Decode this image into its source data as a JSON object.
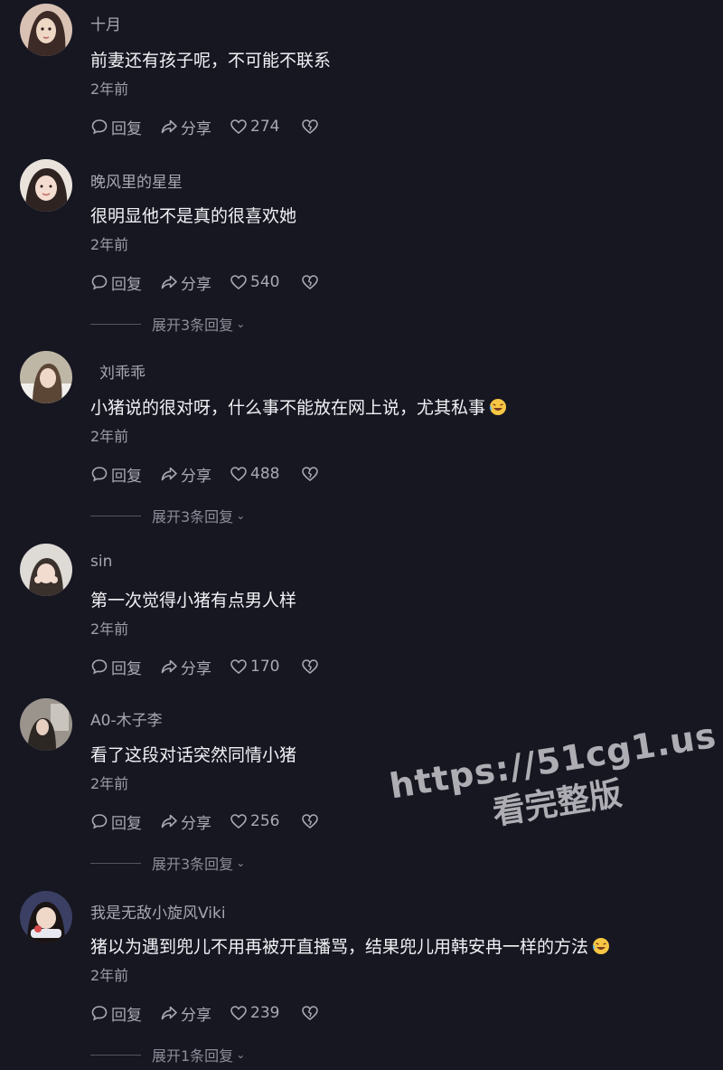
{
  "labels": {
    "reply": "回复",
    "share": "分享"
  },
  "comments": [
    {
      "username": "十月",
      "text": "前妻还有孩子呢，不可能不联系",
      "time": "2年前",
      "likes": "274",
      "expand": ""
    },
    {
      "username": "晚风里的星星",
      "text": "很明显他不是真的很喜欢她",
      "time": "2年前",
      "likes": "540",
      "expand": "展开3条回复"
    },
    {
      "username": "刘乖乖",
      "text": "小猪说的很对呀，什么事不能放在网上说，尤其私事",
      "time": "2年前",
      "likes": "488",
      "expand": "展开3条回复"
    },
    {
      "username": "sin",
      "text": "第一次觉得小猪有点男人样",
      "time": "2年前",
      "likes": "170",
      "expand": ""
    },
    {
      "username": "A0-木子李",
      "text": "看了这段对话突然同情小猪",
      "time": "2年前",
      "likes": "256",
      "expand": "展开3条回复"
    },
    {
      "username": "我是无敌小旋风Viki",
      "text": "猪以为遇到兜儿不用再被开直播骂，结果兜儿用韩安冉一样的方法",
      "time": "2年前",
      "likes": "239",
      "expand": "展开1条回复"
    }
  ],
  "watermark": {
    "line1": "https://51cg1.us",
    "line2": "看完整版"
  },
  "colors": {
    "background": "#171722",
    "text": "#f1f1f5",
    "muted": "#a7a7b2"
  },
  "icons": {
    "reply": "speech-bubble-icon",
    "share": "share-arrow-icon",
    "like": "heart-outline-icon",
    "dislike": "broken-heart-icon",
    "emoji": "rofl-emoji-icon"
  }
}
